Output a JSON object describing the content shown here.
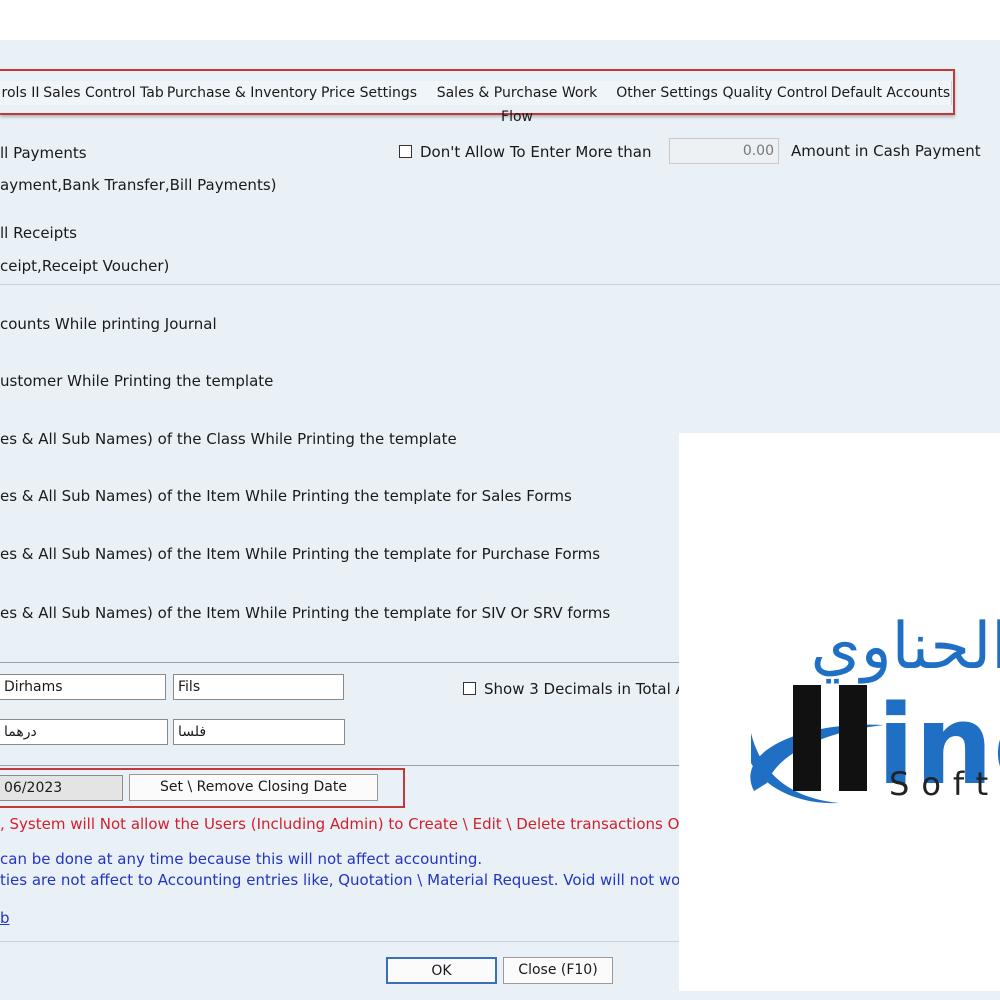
{
  "tabs": [
    "rols II",
    "Sales Control Tab",
    "Purchase & Inventory",
    "Price Settings",
    "Sales & Purchase Work Flow",
    "Other Settings",
    "Quality Control",
    "Default Accounts"
  ],
  "payments": {
    "line1": "ll Payments",
    "line2": "ayment,Bank Transfer,Bill Payments)",
    "line3": "ll Receipts",
    "line4": "ceipt,Receipt Voucher)"
  },
  "cash_limit": {
    "checkbox_label": "Don't Allow To Enter More than",
    "amount": "0.00",
    "suffix": "Amount in Cash Payment"
  },
  "print_options": [
    "counts While printing Journal",
    "ustomer While Printing the template",
    "es & All Sub Names) of the Class While Printing the template",
    "es & All Sub Names) of the Item While Printing the template for Sales Forms",
    "es & All Sub Names) of the Item While Printing the template for Purchase Forms",
    "es & All Sub Names) of the Item While Printing the template for SIV Or SRV forms"
  ],
  "currency": {
    "main_en": "Dirhams",
    "sub_en": "Fils",
    "main_ar": "درهما",
    "sub_ar": "فلسا",
    "show_decimals_label": "Show 3 Decimals in Total A"
  },
  "closing": {
    "date": "06/2023",
    "button": "Set \\ Remove Closing Date",
    "warning": ", System will Not allow the Users (Including Admin)  to Create \\ Edit \\ Delete transactions On o",
    "note1": "can be done at any time because this will not affect accounting.",
    "note2": "ties are not affect to Accounting entries like, Quotation \\ Material Request. Void will not wo"
  },
  "link_fragment": "b",
  "footer": {
    "ok": "OK",
    "close": "Close (F10)"
  },
  "logo": {
    "arabic": "الحناوي",
    "brand": "ind",
    "subtitle": "Soft",
    "colors": {
      "blue": "#1f6fc4",
      "dark": "#111111"
    }
  }
}
